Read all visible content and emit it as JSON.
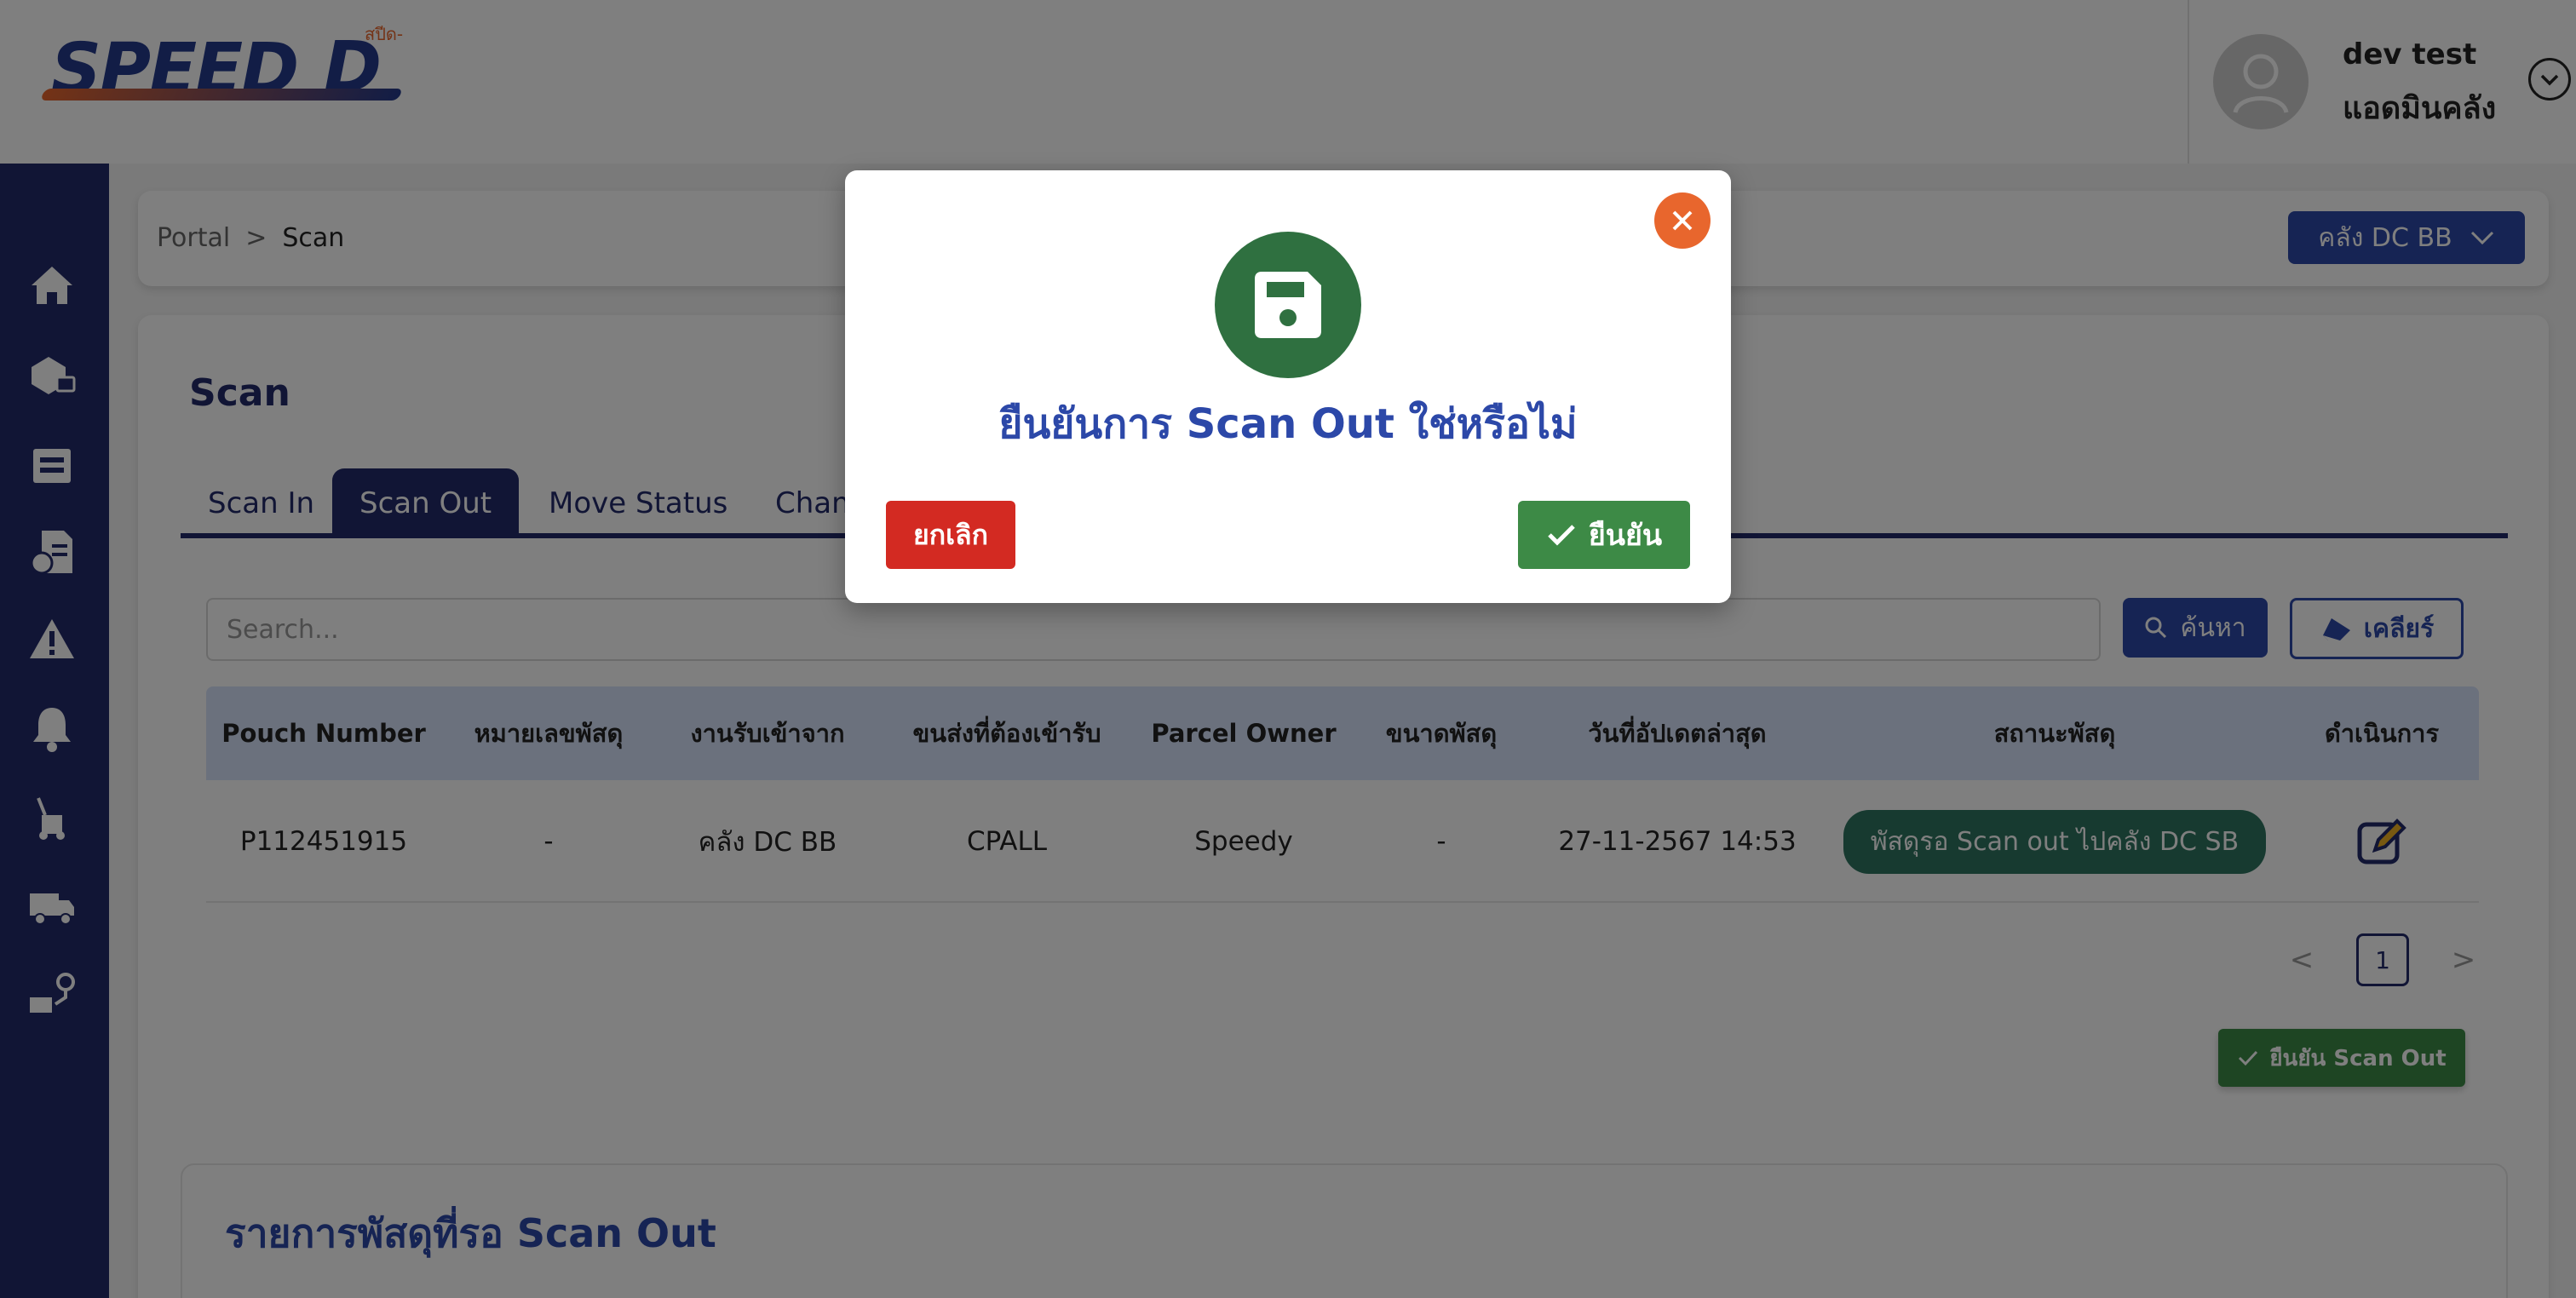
{
  "header": {
    "logo_text": "SPEED",
    "logo_small": "สปีด-ดี",
    "user_name": "dev test",
    "user_role": "แอดมินคลัง"
  },
  "sidebar": {
    "items": [
      {
        "icon": "home-icon"
      },
      {
        "icon": "parcel-scan-icon"
      },
      {
        "icon": "warehouse-icon"
      },
      {
        "icon": "report-icon"
      },
      {
        "icon": "warning-icon"
      },
      {
        "icon": "bell-icon"
      },
      {
        "icon": "dolly-icon"
      },
      {
        "icon": "truck-icon"
      },
      {
        "icon": "route-icon"
      }
    ]
  },
  "breadcrumb": {
    "root": "Portal",
    "separator": ">",
    "current": "Scan"
  },
  "warehouse_select": {
    "label": "คลัง DC BB"
  },
  "page": {
    "title": "Scan"
  },
  "tabs": [
    {
      "label": "Scan In"
    },
    {
      "label": "Scan Out"
    },
    {
      "label": "Move Status"
    },
    {
      "label": "Change"
    }
  ],
  "search": {
    "placeholder": "Search...",
    "search_label": "ค้นหา",
    "clear_label": "เคลียร์"
  },
  "table": {
    "headers": [
      "Pouch Number",
      "หมายเลขพัสดุ",
      "งานรับเข้าจาก",
      "ขนส่งที่ต้องเข้ารับ",
      "Parcel Owner",
      "ขนาดพัสดุ",
      "วันที่อัปเดตล่าสุด",
      "สถานะพัสดุ",
      "ดำเนินการ"
    ],
    "rows": [
      {
        "pouch": "P112451915",
        "parcel_no": "-",
        "received_from": "คลัง DC BB",
        "carrier": "CPALL",
        "owner": "Speedy",
        "size": "-",
        "updated": "27-11-2567 14:53",
        "status": "พัสดุรอ Scan out ไปคลัง DC SB"
      }
    ]
  },
  "pagination": {
    "prev": "<",
    "page": "1",
    "next": ">"
  },
  "confirm_scan_out": {
    "label": "ยืนยัน Scan Out"
  },
  "pending": {
    "title": "รายการพัสดุที่รอ Scan Out"
  },
  "modal": {
    "title": "ยืนยันการ Scan Out ใช่หรือไม่",
    "cancel_label": "ยกเลิก",
    "confirm_label": "ยืนยัน"
  },
  "colors": {
    "primary": "#222a6b",
    "accent_blue": "#2c48a8",
    "success": "#3d8a46",
    "danger": "#d32a22",
    "close": "#e8662d",
    "status_pill": "#2e7560"
  }
}
